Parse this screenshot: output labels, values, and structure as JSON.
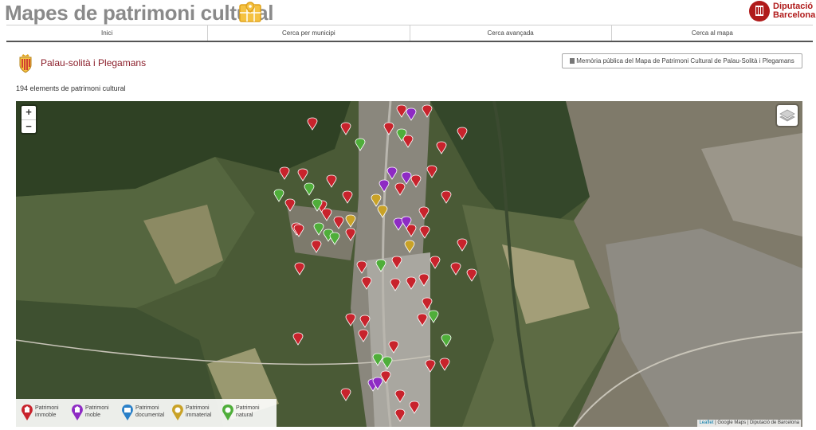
{
  "header": {
    "title": "Mapes de patrimoni cultural",
    "logo_text_line1": "Diputació",
    "logo_text_line2": "Barcelona"
  },
  "nav": {
    "items": [
      "Inici",
      "Cerca per municipi",
      "Cerca avançada",
      "Cerca al mapa"
    ]
  },
  "municipality": {
    "name": "Palau-solità i Plegamans",
    "memoria_button": "Memòria pública del Mapa de Patrimoni Cultural de Palau-Solità i Plegamans"
  },
  "summary": {
    "count_text": "194 elements de patrimoni cultural"
  },
  "map": {
    "zoom_in": "+",
    "zoom_out": "−",
    "attribution_leaflet": "Leaflet",
    "attribution_rest": " | Google Maps | Diputació de Barcelona",
    "legend": [
      {
        "label": "Patrimoni\nimmoble",
        "color": "#c8232c",
        "glyph": "building"
      },
      {
        "label": "Patrimoni\nmoble",
        "color": "#8e2bc4",
        "glyph": "building"
      },
      {
        "label": "Patrimoni\ndocumental",
        "color": "#2a80c8",
        "glyph": "document"
      },
      {
        "label": "Patrimoni\nimmaterial",
        "color": "#c9a227",
        "glyph": "mask"
      },
      {
        "label": "Patrimoni\nnatural",
        "color": "#4fae3a",
        "glyph": "leaf"
      }
    ],
    "colors": {
      "immoble": "#c8232c",
      "moble": "#8e2bc4",
      "documental": "#2a80c8",
      "immaterial": "#c9a227",
      "natural": "#4fae3a"
    }
  }
}
